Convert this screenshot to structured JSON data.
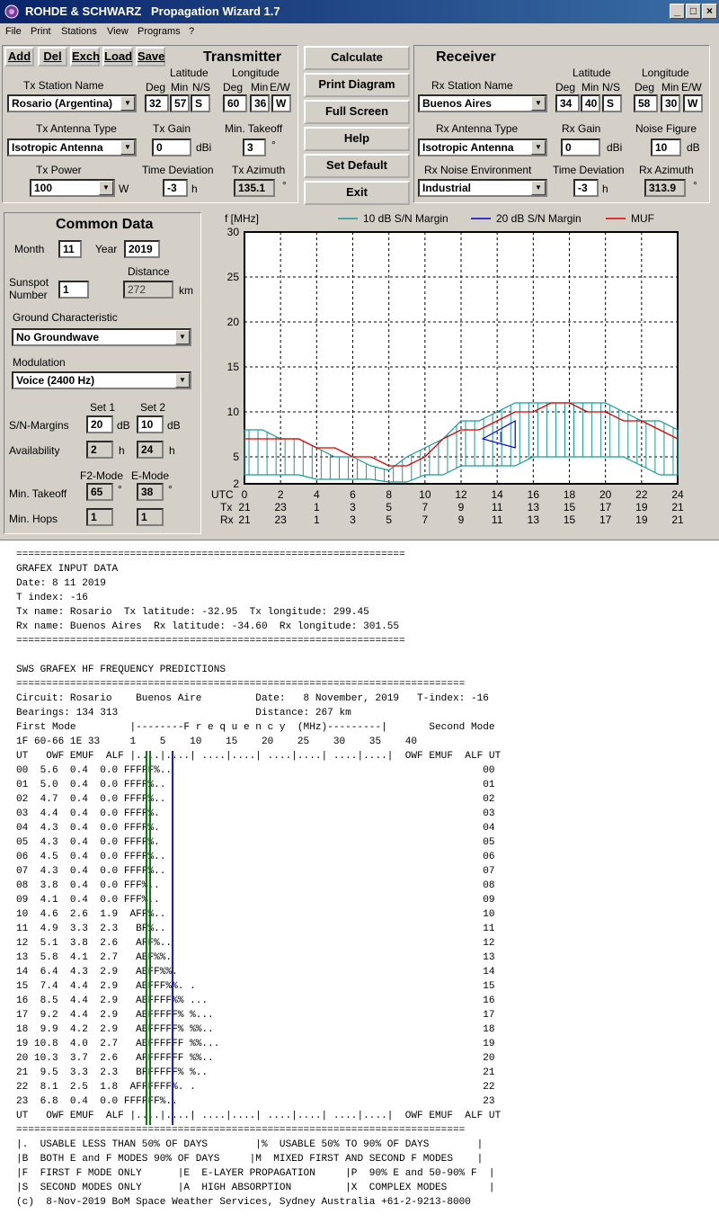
{
  "titlebar": {
    "app_name": "ROHDE & SCHWARZ",
    "window_title": "Propagation Wizard  1.7",
    "minimize": "_",
    "maximize": "□",
    "close": "×"
  },
  "menu": [
    "File",
    "Print",
    "Stations",
    "View",
    "Programs",
    "?"
  ],
  "transmitter": {
    "buttons": [
      "Add",
      "Del",
      "Exch",
      "Load",
      "Save"
    ],
    "heading": "Transmitter",
    "station_label": "Tx Station Name",
    "station": "Rosario (Argentina)",
    "lat_label": "Latitude",
    "lon_label": "Longitude",
    "deg_label": "Deg",
    "min_label": "Min",
    "ns_label": "N/S",
    "ew_label": "E/W",
    "lat_deg": "32",
    "lat_min": "57",
    "lat_ns": "S",
    "lon_deg": "60",
    "lon_min": "36",
    "lon_ew": "W",
    "antenna_label": "Tx Antenna Type",
    "antenna": "Isotropic Antenna",
    "gain_label": "Tx Gain",
    "gain": "0",
    "gain_unit": "dBi",
    "takeoff_label": "Min. Takeoff",
    "takeoff": "3",
    "takeoff_unit": "°",
    "power_label": "Tx Power",
    "power": "100",
    "power_unit": "W",
    "timedev_label": "Time Deviation",
    "timedev": "-3",
    "timedev_unit": "h",
    "azimuth_label": "Tx Azimuth",
    "azimuth": "135.1",
    "azimuth_unit": "°"
  },
  "center_buttons": [
    "Calculate",
    "Print Diagram",
    "Full Screen",
    "Help",
    "Set Default",
    "Exit"
  ],
  "receiver": {
    "heading": "Receiver",
    "station_label": "Rx Station Name",
    "station": "Buenos Aires",
    "lat_label": "Latitude",
    "lon_label": "Longitude",
    "deg_label": "Deg",
    "min_label": "Min",
    "ns_label": "N/S",
    "ew_label": "E/W",
    "lat_deg": "34",
    "lat_min": "40",
    "lat_ns": "S",
    "lon_deg": "58",
    "lon_min": "30",
    "lon_ew": "W",
    "antenna_label": "Rx Antenna Type",
    "antenna": "Isotropic Antenna",
    "gain_label": "Rx Gain",
    "gain": "0",
    "gain_unit": "dBi",
    "noise_label": "Noise Figure",
    "noise": "10",
    "noise_unit": "dB",
    "env_label": "Rx Noise Environment",
    "env": "Industrial",
    "timedev_label": "Time Deviation",
    "timedev": "-3",
    "timedev_unit": "h",
    "azimuth_label": "Rx Azimuth",
    "azimuth": "313.9",
    "azimuth_unit": "°"
  },
  "common": {
    "heading": "Common Data",
    "month_label": "Month",
    "month": "11",
    "year_label": "Year",
    "year": "2019",
    "distance_label": "Distance",
    "sunspot_label_1": "Sunspot",
    "sunspot_label_2": "Number",
    "sunspot": "1",
    "distance": "272",
    "distance_unit": "km",
    "ground_label": "Ground Characteristic",
    "ground": "No Groundwave",
    "modulation_label": "Modulation",
    "modulation": "Voice   (2400 Hz)",
    "set1_label": "Set 1",
    "set2_label": "Set 2",
    "snm_label": "S/N-Margins",
    "snm1": "20",
    "snm2": "10",
    "db_unit": "dB",
    "avail_label": "Availability",
    "avail1": "2",
    "avail2": "24",
    "h_unit": "h",
    "f2_label": "F2-Mode",
    "e_label": "E-Mode",
    "takeoff_label": "Min. Takeoff",
    "takeoff_f2": "65",
    "takeoff_e": "38",
    "deg_unit": "°",
    "hops_label": "Min. Hops",
    "hops_f2": "1",
    "hops_e": "1"
  },
  "chart_data": {
    "type": "area",
    "ylabel": "f [MHz]",
    "xlabel": "UTC",
    "ylim": [
      2,
      30
    ],
    "yticks": [
      2,
      5,
      10,
      15,
      20,
      25,
      30
    ],
    "xlim": [
      0,
      24
    ],
    "xticks": [
      0,
      2,
      4,
      6,
      8,
      10,
      12,
      14,
      16,
      18,
      20,
      22,
      24
    ],
    "tx_row_label": "Tx",
    "rx_row_label": "Rx",
    "tx_hours": [
      21,
      23,
      1,
      3,
      5,
      7,
      9,
      11,
      13,
      15,
      17,
      19,
      21
    ],
    "rx_hours": [
      21,
      23,
      1,
      3,
      5,
      7,
      9,
      11,
      13,
      15,
      17,
      19,
      21
    ],
    "grid": true,
    "legend_position": "top",
    "x": [
      0,
      1,
      2,
      3,
      4,
      5,
      6,
      7,
      8,
      9,
      10,
      11,
      12,
      13,
      14,
      15,
      16,
      17,
      18,
      19,
      20,
      21,
      22,
      23,
      24
    ],
    "series": [
      {
        "name": "10 dB S/N Margin",
        "color": "#1a9a9a",
        "upper": [
          8,
          8,
          7,
          7,
          6,
          5,
          5,
          4,
          3.5,
          5,
          6,
          7,
          9,
          9,
          10,
          11,
          11,
          11,
          11,
          11,
          11,
          10,
          9,
          9,
          8
        ],
        "lower": [
          3,
          3,
          3,
          3,
          2.5,
          2.5,
          2.5,
          2.5,
          2.2,
          2.2,
          3,
          3,
          4,
          4,
          4,
          4,
          5,
          5,
          5,
          5,
          5,
          5,
          4,
          3,
          3
        ]
      },
      {
        "name": "20 dB S/N Margin",
        "color": "#0000cc",
        "upper": [
          7,
          9
        ],
        "lower": [
          7,
          6
        ],
        "x": [
          13.2,
          15
        ]
      },
      {
        "name": "MUF",
        "color": "#e00000",
        "values": [
          7,
          7,
          7,
          7,
          6,
          6,
          5,
          5,
          4,
          4,
          5,
          7,
          8,
          8,
          9,
          10,
          10,
          11,
          11,
          10,
          10,
          9,
          9,
          8,
          7
        ]
      }
    ]
  },
  "report": {
    "lines": [
      "=================================================================",
      "GRAFEX INPUT DATA",
      "Date: 8 11 2019",
      "T index: -16",
      "Tx name: Rosario  Tx latitude: -32.95  Tx longitude: 299.45",
      "Rx name: Buenos Aires  Rx latitude: -34.60  Rx longitude: 301.55",
      "=================================================================",
      "",
      "SWS GRAFEX HF FREQUENCY PREDICTIONS",
      "===========================================================================",
      "Circuit: Rosario    Buenos Aire         Date:   8 November, 2019   T-index: -16",
      "Bearings: 134 313                       Distance: 267 km",
      "First Mode         |--------F r e q u e n c y  (MHz)---------|       Second Mode",
      "1F 60-66 1E 33     1    5    10    15    20    25    30    35    40",
      "UT   OWF EMUF  ALF |....|....| ....|....| ....|....| ....|....|  OWF EMUF  ALF UT",
      "00  5.6  0.4  0.0 FFFFF%..                                                    00",
      "01  5.0  0.4  0.0 FFFF%..                                                     01",
      "02  4.7  0.4  0.0 FFFF%..                                                     02",
      "03  4.4  0.4  0.0 FFFF%.                                                      03",
      "04  4.3  0.4  0.0 FFFF%.                                                      04",
      "05  4.3  0.4  0.0 FFFF%.                                                      05",
      "06  4.5  0.4  0.0 FFFF%..                                                     06",
      "07  4.3  0.4  0.0 FFFF%..                                                     07",
      "08  3.8  0.4  0.0 FFF%..                                                      08",
      "09  4.1  0.4  0.0 FFF%..                                                      09",
      "10  4.6  2.6  1.9  AFF%..                                                     10",
      "11  4.9  3.3  2.3   BF%..                                                     11",
      "12  5.1  3.8  2.6   AFF%..                                                    12",
      "13  5.8  4.1  2.7   ABF%%.                                                    13",
      "14  6.4  4.3  2.9   ABFF%%.                                                   14",
      "15  7.4  4.4  2.9   ABFFF%%. .                                                15",
      "16  8.5  4.4  2.9   ABFFFF%% ...                                              16",
      "17  9.2  4.4  2.9   ABFFFFF% %...                                             17",
      "18  9.9  4.2  2.9   ABFFFFF% %%..                                             18",
      "19 10.8  4.0  2.7   ABFFFFFF %%...                                            19",
      "20 10.3  3.7  2.6   AFFFFFFF %%..                                             20",
      "21  9.5  3.3  2.3   BFFFFFF% %..                                              21",
      "22  8.1  2.5  1.8  AFFFFFF%. .                                                22",
      "23  6.8  0.4  0.0 FFFFFF%..                                                   23",
      "UT   OWF EMUF  ALF |....|....| ....|....| ....|....| ....|....|  OWF EMUF  ALF UT",
      "===========================================================================",
      "|.  USABLE LESS THAN 50% OF DAYS        |%  USABLE 50% TO 90% OF DAYS        |",
      "|B  BOTH E and F MODES 90% OF DAYS     |M  MIXED FIRST AND SECOND F MODES    |",
      "|F  FIRST F MODE ONLY      |E  E-LAYER PROPAGATION     |P  90% E and 50-90% F  |",
      "|S  SECOND MODES ONLY      |A  HIGH ABSORPTION         |X  COMPLEX MODES       |",
      "(c)  8-Nov-2019 BoM Space Weather Services, Sydney Australia +61-2-9213-8000"
    ]
  }
}
